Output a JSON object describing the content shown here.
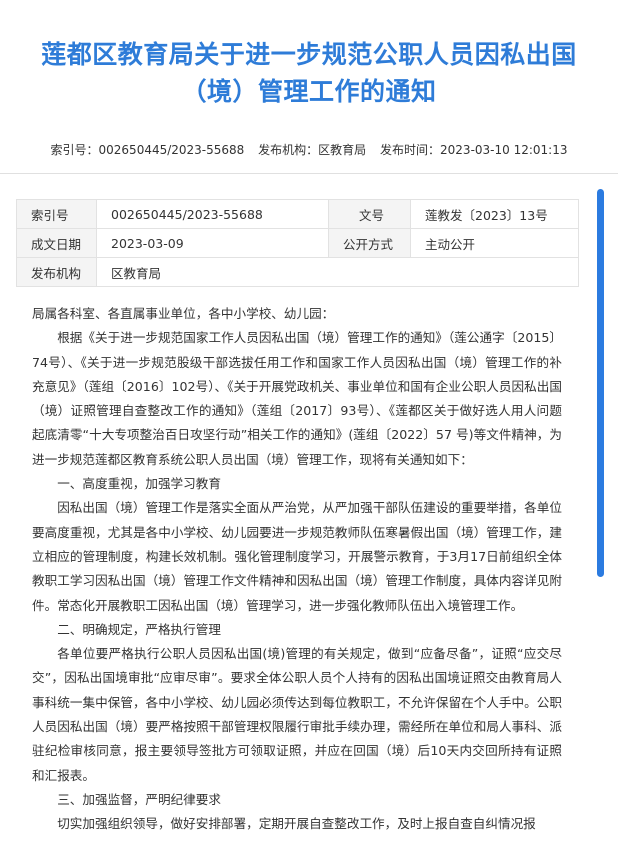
{
  "title": "莲都区教育局关于进一步规范公职人员因私出国（境）管理工作的通知",
  "meta": {
    "index_label": "索引号：",
    "index_value": "002650445/2023-55688",
    "org_label": "发布机构：",
    "org_value": "区教育局",
    "time_label": "发布时间：",
    "time_value": "2023-03-10 12:01:13"
  },
  "info_table": {
    "row1": [
      "索引号",
      "002650445/2023-55688",
      "文号",
      "莲教发〔2023〕13号"
    ],
    "row2": [
      "成文日期",
      "2023-03-09",
      "公开方式",
      "主动公开"
    ],
    "row3": [
      "发布机构",
      "区教育局"
    ]
  },
  "body": {
    "salutation": "局属各科室、各直属事业单位，各中小学校、幼儿园：",
    "p1": "根据《关于进一步规范国家工作人员因私出国（境）管理工作的通知》（莲公通字〔2015〕74号）、《关于进一步规范股级干部选拔任用工作和国家工作人员因私出国（境）管理工作的补充意见》（莲组〔2016〕102号）、《关于开展党政机关、事业单位和国有企业公职人员因私出国（境）证照管理自查整改工作的通知》（莲组〔2017〕93号）、《莲都区关于做好选人用人问题起底清零“十大专项整治百日攻坚行动”相关工作的通知》(莲组〔2022〕57 号)等文件精神，为进一步规范莲都区教育系统公职人员出国（境）管理工作，现将有关通知如下：",
    "h1": "一、高度重视，加强学习教育",
    "p2": "因私出国（境）管理工作是落实全面从严治党，从严加强干部队伍建设的重要举措，各单位要高度重视，尤其是各中小学校、幼儿园要进一步规范教师队伍寒暑假出国（境）管理工作，建立相应的管理制度，构建长效机制。强化管理制度学习，开展警示教育，于3月17日前组织全体教职工学习因私出国（境）管理工作文件精神和因私出国（境）管理工作制度，具体内容详见附件。常态化开展教职工因私出国（境）管理学习，进一步强化教师队伍出入境管理工作。",
    "h2": "二、明确规定，严格执行管理",
    "p3": "各单位要严格执行公职人员因私出国(境)管理的有关规定，做到“应备尽备”，证照“应交尽交”，因私出国境审批“应审尽审”。要求全体公职人员个人持有的因私出国境证照交由教育局人事科统一集中保管，各中小学校、幼儿园必须传达到每位教职工，不允许保留在个人手中。公职人员因私出国（境）要严格按照干部管理权限履行审批手续办理，需经所在单位和局人事科、派驻纪检审核同意，报主要领导签批方可领取证照，并应在回国（境）后10天内交回所持有证照和汇报表。",
    "h3": "三、加强监督，严明纪律要求",
    "p4": "切实加强组织领导，做好安排部署，定期开展自查整改工作，及时上报自查自纠情况报"
  }
}
